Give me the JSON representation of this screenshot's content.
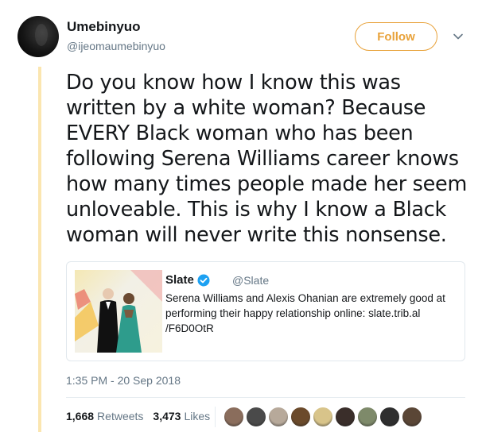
{
  "author": {
    "display_name": "Umebinyuo",
    "handle": "@ijeomaumebinyuo",
    "avatar_icon": "profile-photo"
  },
  "actions": {
    "follow_label": "Follow",
    "follow_color": "#e8a23a",
    "more_icon": "chevron-down-icon"
  },
  "tweet": {
    "lines": [
      "Do you know how I know this was",
      "written by a white woman? Because",
      "EVERY Black woman who has been",
      "following Serena Williams career knows",
      "how many times people made her seem",
      "unloveable. This is why I know a Black",
      "woman will never write this nonsense."
    ],
    "timestamp": "1:35 PM - 20 Sep 2018"
  },
  "quote": {
    "author": "Slate",
    "verified": true,
    "handle": "@Slate",
    "body_lines": [
      "Serena Williams and Alexis Ohanian are extremely good at",
      "performing their happy relationship online: slate.trib.al",
      "/F6D0OtR"
    ],
    "image_icon": "couple-photo"
  },
  "stats": {
    "retweets_count": "1,668",
    "retweets_label": "Retweets",
    "likes_count": "3,473",
    "likes_label": "Likes"
  },
  "likers": [
    {
      "color": "#8a6d5c"
    },
    {
      "color": "#4a4a4a"
    },
    {
      "color": "#b7a99a"
    },
    {
      "color": "#6b4a2b"
    },
    {
      "color": "#d8c48a"
    },
    {
      "color": "#3a2e2a"
    },
    {
      "color": "#7e8a6a"
    },
    {
      "color": "#2e2e2e"
    },
    {
      "color": "#5a4636"
    }
  ]
}
